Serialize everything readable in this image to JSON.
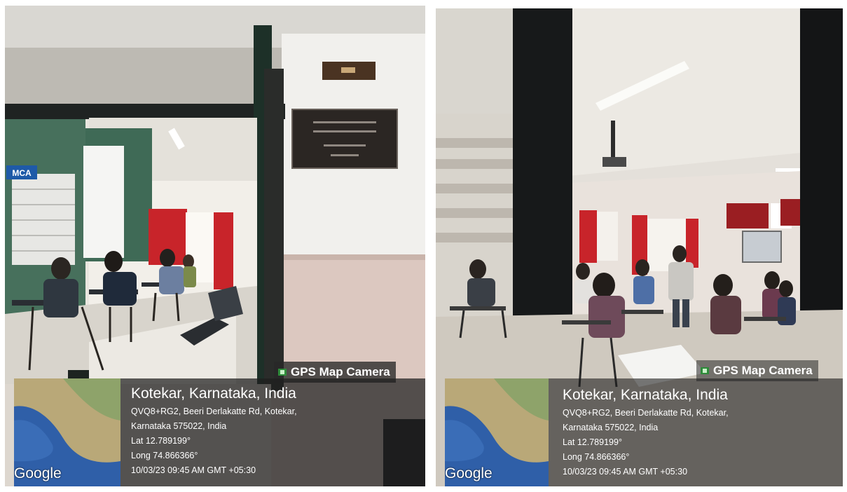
{
  "photos": [
    {
      "overlay_label": "GPS Map Camera",
      "map_brand": "Google",
      "location_title": "Kotekar, Karnataka, India",
      "address_line1": "QVQ8+RG2, Beeri Derlakatte Rd, Kotekar,",
      "address_line2": "Karnataka 575022, India",
      "latitude": "Lat 12.789199°",
      "longitude": "Long 74.866366°",
      "timestamp": "10/03/23 09:45 AM GMT +05:30"
    },
    {
      "overlay_label": "GPS Map Camera",
      "map_brand": "Google",
      "location_title": "Kotekar, Karnataka, India",
      "address_line1": "QVQ8+RG2, Beeri Derlakatte Rd, Kotekar,",
      "address_line2": "Karnataka 575022, India",
      "latitude": "Lat 12.789199°",
      "longitude": "Long 74.866366°",
      "timestamp": "10/03/23 09:45 AM GMT +05:30"
    }
  ],
  "scene_text": {
    "door_sign": "MCA"
  },
  "colors": {
    "overlay_bg": "#282828",
    "map_sea": "#2f5fa8",
    "map_land": "#b9a878",
    "curtain_red": "#c8242a"
  }
}
